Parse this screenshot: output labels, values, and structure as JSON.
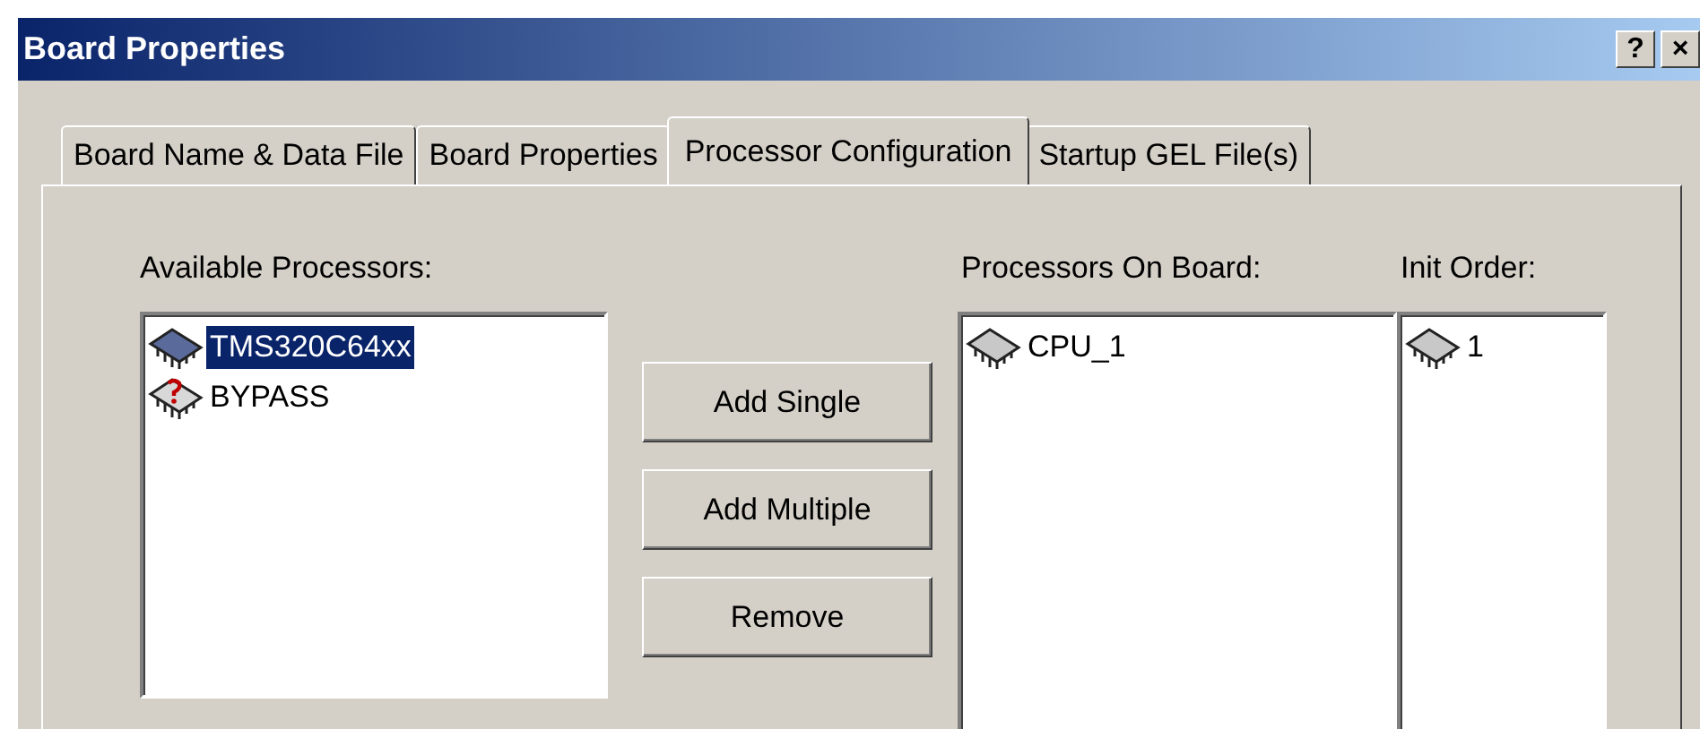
{
  "window": {
    "title": "Board Properties",
    "title_buttons": [
      "?",
      "×"
    ]
  },
  "tabs": [
    {
      "label": "Board Name & Data File",
      "selected": false
    },
    {
      "label": "Board Properties",
      "selected": false
    },
    {
      "label": "Processor Configuration",
      "selected": true
    },
    {
      "label": "Startup GEL File(s)",
      "selected": false
    }
  ],
  "available_processors": {
    "label": "Available Processors:",
    "items": [
      {
        "name": "TMS320C64xx",
        "kind": "chip",
        "selected": true
      },
      {
        "name": "BYPASS",
        "kind": "unknown",
        "selected": false
      }
    ]
  },
  "buttons": [
    "Add Single",
    "Add Multiple",
    "Remove"
  ],
  "processors_on_board": {
    "label": "Processors On Board:",
    "items": [
      {
        "name": "CPU_1",
        "kind": "chip",
        "selected": false
      }
    ]
  },
  "init_order": {
    "label": "Init Order:",
    "items": [
      {
        "name": "1",
        "kind": "chip",
        "selected": false
      }
    ]
  }
}
